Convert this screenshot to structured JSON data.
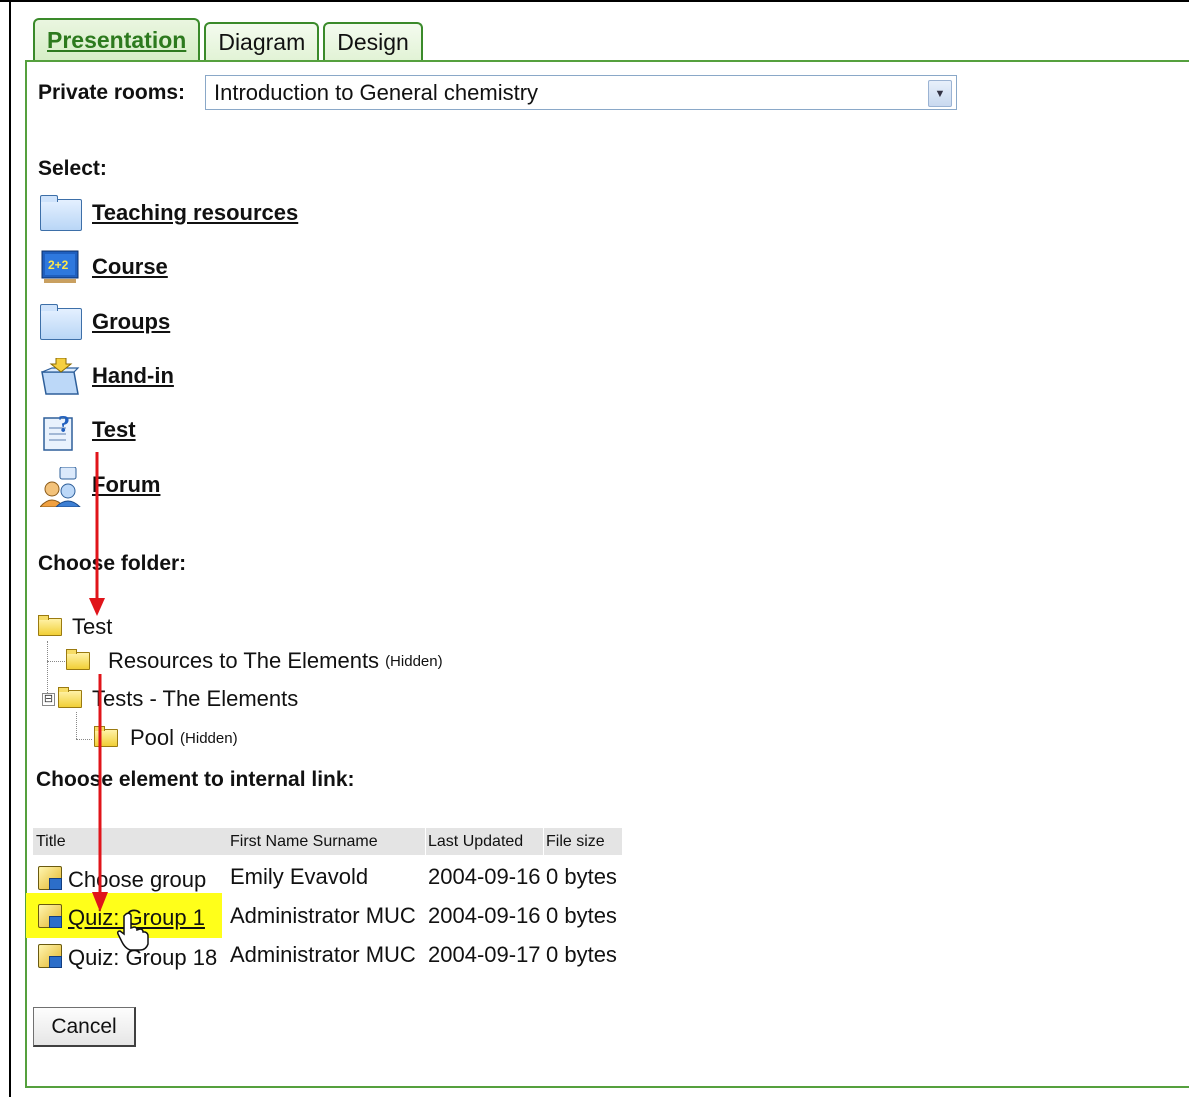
{
  "tabs": [
    {
      "label": "Presentation",
      "active": true
    },
    {
      "label": "Diagram",
      "active": false
    },
    {
      "label": "Design",
      "active": false
    }
  ],
  "private_rooms": {
    "label": "Private rooms:",
    "selected": "Introduction to General chemistry"
  },
  "select_section": {
    "heading": "Select:",
    "items": [
      {
        "label": "Teaching resources",
        "icon": "folder-icon"
      },
      {
        "label": "Course",
        "icon": "course-icon"
      },
      {
        "label": "Groups",
        "icon": "folder-icon"
      },
      {
        "label": "Hand-in",
        "icon": "hand-in-icon"
      },
      {
        "label": "Test",
        "icon": "test-icon"
      },
      {
        "label": "Forum",
        "icon": "forum-icon"
      }
    ]
  },
  "folder_section": {
    "heading": "Choose folder:",
    "tree": {
      "root": "Test",
      "child1": {
        "label": "Resources to The Elements",
        "tag": "(Hidden)"
      },
      "child2": {
        "label": "Tests - The Elements",
        "expander": "⊟"
      },
      "grandchild": {
        "label": "Pool",
        "tag": "(Hidden)"
      }
    }
  },
  "element_section": {
    "heading": "Choose element to internal link:",
    "columns": [
      "Title",
      "First Name Surname",
      "Last Updated",
      "File size"
    ],
    "rows": [
      {
        "title": "Choose group",
        "author": "Emily Evavold",
        "updated": "2004-09-16",
        "size": "0 bytes"
      },
      {
        "title": "Quiz: Group 1",
        "author": "Administrator MUC",
        "updated": "2004-09-16",
        "size": "0 bytes"
      },
      {
        "title": "Quiz: Group 18",
        "author": "Administrator MUC",
        "updated": "2004-09-17",
        "size": "0 bytes"
      }
    ]
  },
  "cancel_label": "Cancel",
  "colors": {
    "tab_border": "#3a8a2a",
    "highlight": "#ffff1a",
    "arrow": "#e0141a"
  }
}
